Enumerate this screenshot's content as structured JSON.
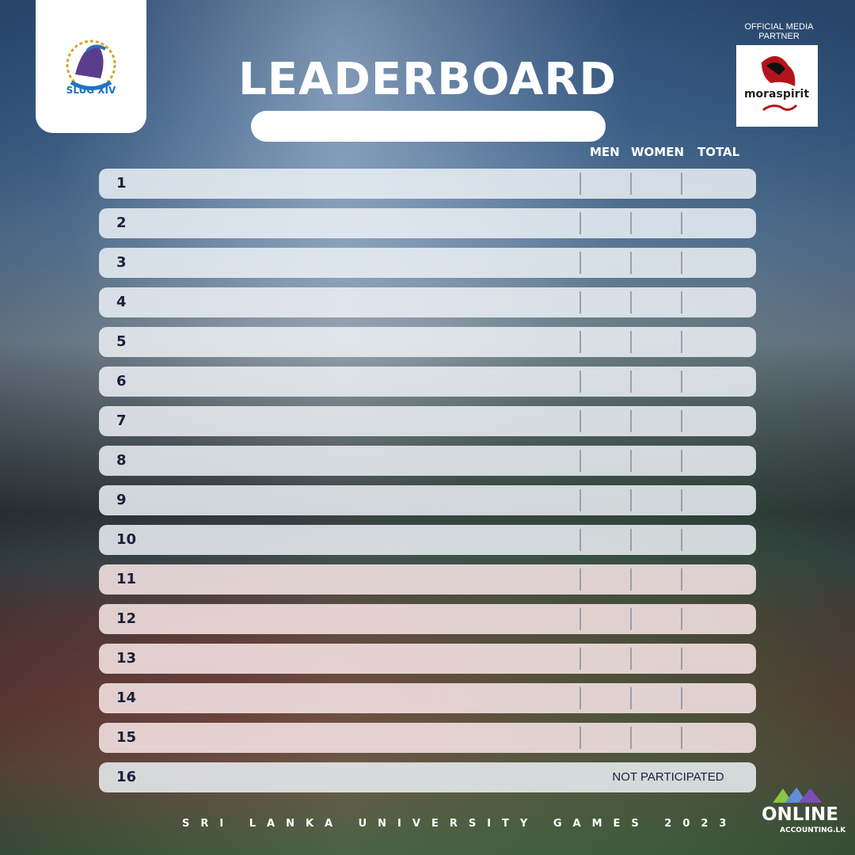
{
  "header": {
    "title": "LEADERBOARD",
    "media_partner_label": "OFFICIAL MEDIA PARTNER",
    "media_partner_name": "moraspirit",
    "event_logo_text": "SLUG XIV"
  },
  "columns": {
    "men": "MEN",
    "women": "WOMEN",
    "total": "TOTAL"
  },
  "rows": [
    {
      "rank": "1"
    },
    {
      "rank": "2"
    },
    {
      "rank": "3"
    },
    {
      "rank": "4"
    },
    {
      "rank": "5"
    },
    {
      "rank": "6"
    },
    {
      "rank": "7"
    },
    {
      "rank": "8"
    },
    {
      "rank": "9"
    },
    {
      "rank": "10"
    },
    {
      "rank": "11"
    },
    {
      "rank": "12"
    },
    {
      "rank": "13"
    },
    {
      "rank": "14"
    },
    {
      "rank": "15"
    },
    {
      "rank": "16",
      "note": "NOT PARTICIPATED"
    }
  ],
  "footer": {
    "event_name": "SRI LANKA UNIVERSITY GAMES 2023",
    "sponsor_line1": "ONLINE",
    "sponsor_line2": "ACCOUNTING.LK"
  },
  "colors": {
    "rank_text": "#1c1f3a",
    "brand_red": "#b3141c"
  }
}
